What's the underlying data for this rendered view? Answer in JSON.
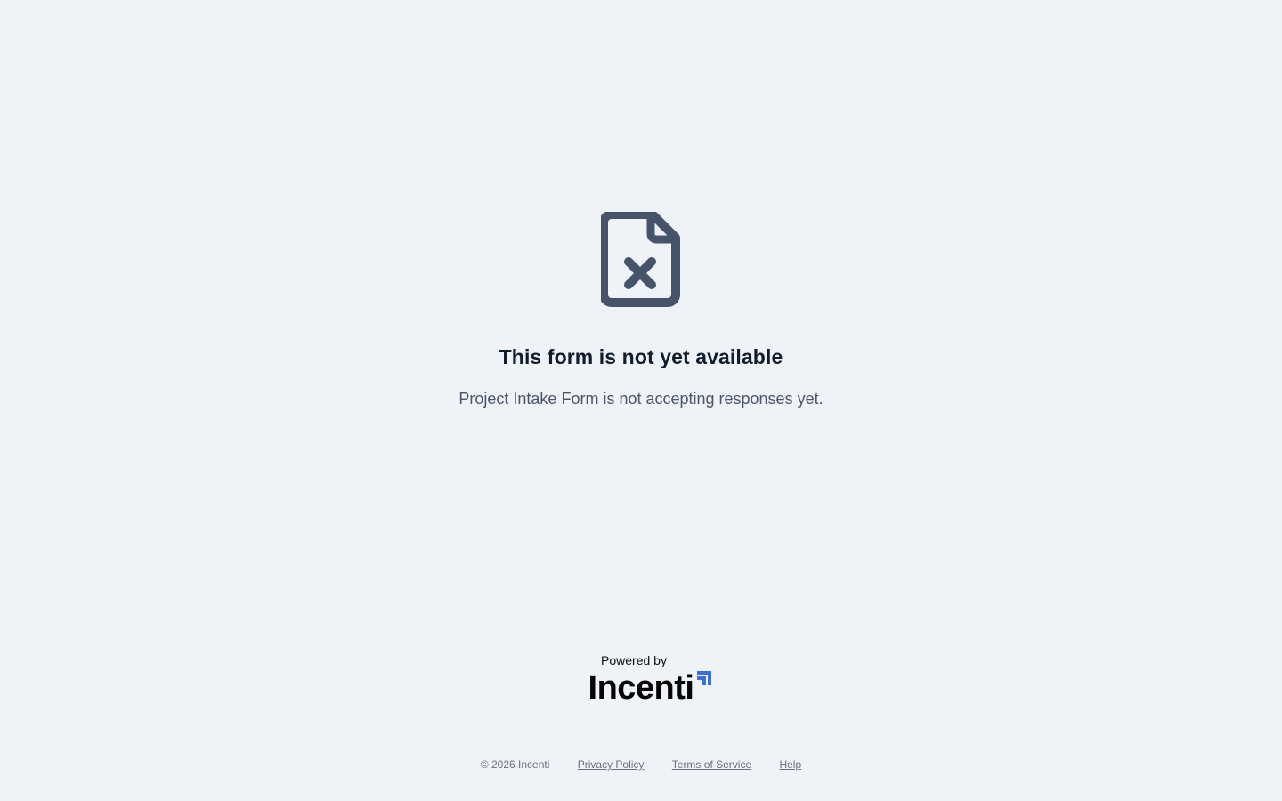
{
  "status": {
    "icon": "file-x-icon",
    "title": "This form is not yet available",
    "message": "Project Intake Form is not accepting responses yet."
  },
  "branding": {
    "powered_by_label": "Powered by",
    "brand_name": "Incenti",
    "brand_mark_icon": "arrow-up-right-icon",
    "brand_accent": "#3b6fe0"
  },
  "footer": {
    "copyright": "© 2026 Incenti",
    "links": [
      {
        "label": "Privacy Policy"
      },
      {
        "label": "Terms of Service"
      },
      {
        "label": "Help"
      }
    ]
  },
  "colors": {
    "background": "#eff3f8",
    "icon": "#455468",
    "title": "#111c2e",
    "text": "#4b5567"
  }
}
